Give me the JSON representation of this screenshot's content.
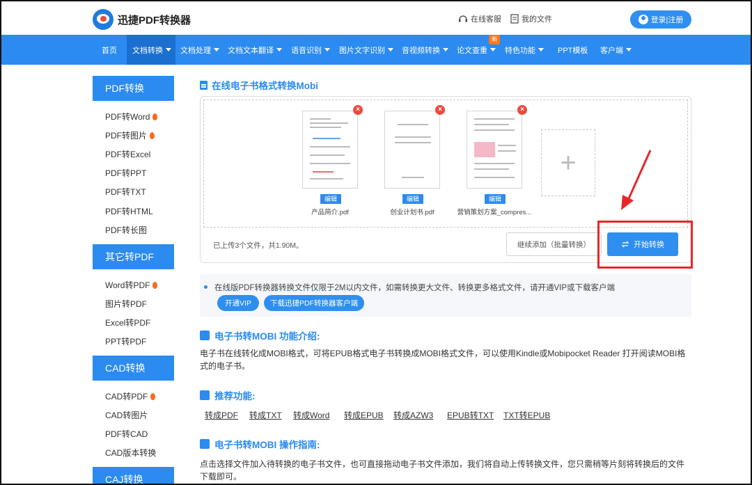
{
  "header": {
    "app_name": "迅捷PDF转换器",
    "service_label": "在线客服",
    "my_files_label": "我的文件",
    "login_label": "登录|注册"
  },
  "nav": {
    "items": [
      {
        "label": "首页",
        "active": false
      },
      {
        "label": "文档转换",
        "active": true
      },
      {
        "label": "文档处理"
      },
      {
        "label": "文档文本翻译"
      },
      {
        "label": "语音识别"
      },
      {
        "label": "图片文字识别"
      },
      {
        "label": "音视频转换"
      },
      {
        "label": "论文查重"
      },
      {
        "label": "特色功能"
      },
      {
        "label": "PPT模板"
      },
      {
        "label": "客户端"
      }
    ],
    "new_badge": "新"
  },
  "sidebar": {
    "groups": [
      {
        "title": "PDF转换",
        "items": [
          "PDF转Word",
          "PDF转图片",
          "PDF转Excel",
          "PDF转PPT",
          "PDF转TXT",
          "PDF转HTML",
          "PDF转长图"
        ]
      },
      {
        "title": "其它转PDF",
        "items": [
          "Word转PDF",
          "图片转PDF",
          "Excel转PDF",
          "PPT转PDF"
        ]
      },
      {
        "title": "CAD转换",
        "items": [
          "CAD转PDF",
          "CAD转图片",
          "PDF转CAD",
          "CAD版本转换"
        ]
      },
      {
        "title": "CAJ转换",
        "items": []
      }
    ]
  },
  "main": {
    "title": "在线电子书格式转换Mobi",
    "files": [
      {
        "name": "产品简介.pdf",
        "edit": "编辑"
      },
      {
        "name": "创业计划书.pdf",
        "edit": "编辑"
      },
      {
        "name": "营销策划方案_compres...",
        "edit": "编辑"
      }
    ],
    "delete_symbol": "×",
    "add_symbol": "+",
    "upload_info": "已上传3个文件，共1.90M。",
    "continue_label": "继续添加（批量转换）",
    "start_label": "开始转换",
    "notice": "在线版PDF转换器转换文件仅限于2M以内文件，如需转换更大文件、转换更多格式文件，请开通VIP或下载客户端",
    "vip_label": "开通VIP",
    "download_label": "下载迅捷PDF转换器客户端",
    "intro_title": "电子书转MOBI 功能介绍:",
    "intro_text": "电子书在线转化成MOBI格式，可将EPUB格式电子书转换成MOBI格式文件，可以使用Kindle或Mobipocket Reader 打开阅读MOBI格式的电子书。",
    "recommend_title": "推荐功能:",
    "recommend_links": [
      "转成PDF",
      "转成TXT",
      "转成Word",
      "转成EPUB",
      "转成AZW3",
      "EPUB转TXT",
      "TXT转EPUB"
    ],
    "guide_title": "电子书转MOBI 操作指南:",
    "guide_text": "点击选择文件加入待转换的电子书文件，也可直接拖动电子书文件添加，我们将自动上传转换文件，您只需稍等片刻将转换后的文件下载即可。"
  },
  "colors": {
    "accent": "#2b8bf0",
    "highlight": "#e8262a",
    "delete": "#ee4a3c"
  }
}
